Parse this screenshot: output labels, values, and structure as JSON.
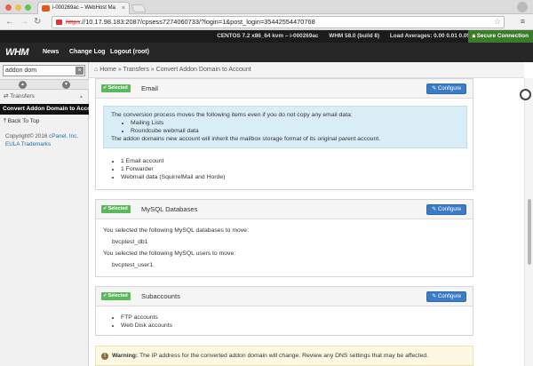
{
  "browser": {
    "tab_title": "i-000269ac – WebHost Ma",
    "url_scheme": "https",
    "url_rest": "://10.17.98.183:2087/cpsess7274060733/?login=1&post_login=35442554470768"
  },
  "whm_bar": {
    "os": "CENTOS 7.2 x86_64 kvm – i-000269ac",
    "version": "WHM 58.0 (build 8)",
    "load": "Load Averages: 0.00 0.01 0.05",
    "secure": "Secure Connection"
  },
  "nav": {
    "logo": "WHM",
    "news": "News",
    "change_log": "Change Log",
    "logout": "Logout (root)"
  },
  "sidebar": {
    "search_value": "addon dom",
    "section": "Transfers",
    "active_item": "Convert Addon Domain to Account",
    "back": "Back To Top",
    "copyright": "Copyright© 2016",
    "cpanel": "cPanel, Inc.",
    "eula": "EULA",
    "trademarks": "Trademarks"
  },
  "breadcrumb": {
    "home": "Home",
    "transfers": "Transfers",
    "current": "Convert Addon Domain to Account"
  },
  "common": {
    "selected": "Selected",
    "configure": "Configure"
  },
  "email": {
    "title": "Email",
    "info_line": "The conversion process moves the following items even if you do not copy any email data:",
    "info_items": [
      "Mailing Lists",
      "Roundcube webmail data"
    ],
    "info_line2": "The addon domains new account will inherit the mailbox storage format of its original parent account.",
    "items": [
      "1 Email account",
      "1 Forwarder",
      "Webmail data (SquirrelMail and Horde)"
    ]
  },
  "mysql": {
    "title": "MySQL Databases",
    "db_intro": "You selected the following MySQL databases to move:",
    "db": "bvcptest_db1",
    "user_intro": "You selected the following MySQL users to move:",
    "user": "bvcptest_user1"
  },
  "subaccounts": {
    "title": "Subaccounts",
    "items": [
      "FTP accounts",
      "Web Disk accounts"
    ]
  },
  "warning": {
    "label": "Warning:",
    "text": "The IP address for the converted addon domain will change. Review any DNS settings that may be affected."
  }
}
